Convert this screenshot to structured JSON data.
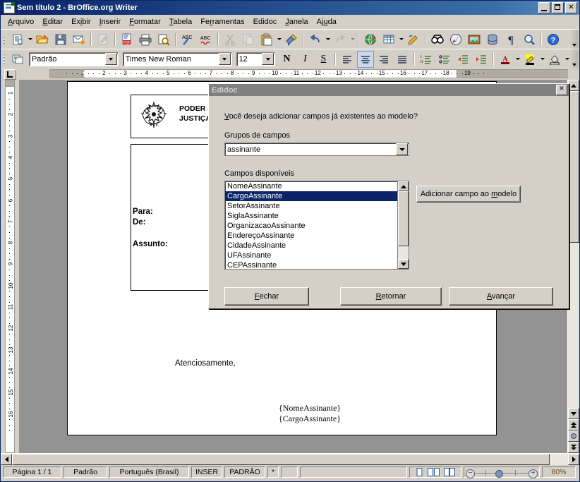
{
  "window": {
    "title": "Sem título 2 - BrOffice.org Writer",
    "icon": "writer-document-icon",
    "buttons": {
      "minimize": "minimize-button",
      "maximize": "maximize-button",
      "close_label": "✕"
    }
  },
  "menubar": [
    {
      "label": "Arquivo",
      "accel": "A"
    },
    {
      "label": "Editar",
      "accel": "E"
    },
    {
      "label": "Exibir",
      "accel": "i"
    },
    {
      "label": "Inserir",
      "accel": "I"
    },
    {
      "label": "Formatar",
      "accel": "F"
    },
    {
      "label": "Tabela",
      "accel": "T"
    },
    {
      "label": "Ferramentas",
      "accel": "r"
    },
    {
      "label": "Edidoc",
      "accel": "d"
    },
    {
      "label": "Janela",
      "accel": "J"
    },
    {
      "label": "Ajuda",
      "accel": "u"
    }
  ],
  "standard_toolbar": [
    {
      "name": "new-document-icon",
      "tip": "Novo"
    },
    {
      "name": "new-dropdown-arrow",
      "tip": "Novo (menu)"
    },
    {
      "name": "open-folder-icon",
      "tip": "Abrir"
    },
    {
      "name": "save-icon",
      "tip": "Salvar"
    },
    {
      "name": "send-email-icon",
      "tip": "Documento como e-mail"
    },
    {
      "name": "edit-file-icon",
      "tip": "Editar arquivo"
    },
    {
      "name": "export-pdf-icon",
      "tip": "Exportar como PDF"
    },
    {
      "name": "print-icon",
      "tip": "Imprimir"
    },
    {
      "name": "print-preview-icon",
      "tip": "Visualizar página"
    },
    {
      "name": "spellcheck-icon",
      "tip": "Ortografia e gramática"
    },
    {
      "name": "autospellcheck-icon",
      "tip": "Verificação ortográfica automática"
    },
    {
      "name": "cut-icon",
      "tip": "Cortar"
    },
    {
      "name": "copy-icon",
      "tip": "Copiar"
    },
    {
      "name": "paste-icon",
      "tip": "Colar"
    },
    {
      "name": "paste-dropdown-arrow",
      "tip": "Colar (menu)"
    },
    {
      "name": "clone-formatting-icon",
      "tip": "Pincel de estilo"
    },
    {
      "name": "undo-icon",
      "tip": "Desfazer"
    },
    {
      "name": "undo-dropdown-arrow",
      "tip": "Desfazer (menu)"
    },
    {
      "name": "redo-icon",
      "tip": "Refazer"
    },
    {
      "name": "redo-dropdown-arrow",
      "tip": "Refazer (menu)"
    },
    {
      "name": "hyperlink-icon",
      "tip": "Hyperlink"
    },
    {
      "name": "insert-table-icon",
      "tip": "Tabela"
    },
    {
      "name": "table-dropdown-arrow",
      "tip": "Tabela (menu)"
    },
    {
      "name": "show-draw-functions-icon",
      "tip": "Funções de desenho"
    },
    {
      "name": "find-replace-icon",
      "tip": "Localizar e substituir"
    },
    {
      "name": "navigator-icon",
      "tip": "Navegador"
    },
    {
      "name": "gallery-icon",
      "tip": "Galeria"
    },
    {
      "name": "data-sources-icon",
      "tip": "Fontes de dados"
    },
    {
      "name": "formatting-marks-icon",
      "tip": "Caracteres não imprimíveis"
    },
    {
      "name": "zoom-icon",
      "tip": "Zoom"
    },
    {
      "name": "help-icon",
      "tip": "Ajuda do BrOffice.org"
    }
  ],
  "format_toolbar": {
    "paragraph_style_icon": "apply-style-icon",
    "paragraph_style": "Padrão",
    "font_name": "Times New Roman",
    "font_size": "12",
    "bold": "N",
    "italic": "I",
    "underline": "S",
    "buttons": [
      {
        "name": "align-left-button",
        "active": false
      },
      {
        "name": "align-center-button",
        "active": true
      },
      {
        "name": "align-right-button",
        "active": false
      },
      {
        "name": "justify-button",
        "active": false
      },
      {
        "name": "ordered-list-button",
        "active": false
      },
      {
        "name": "unordered-list-button",
        "active": false
      },
      {
        "name": "decrease-indent-button",
        "active": false
      },
      {
        "name": "increase-indent-button",
        "active": false
      },
      {
        "name": "font-color-button",
        "active": false
      },
      {
        "name": "highlighting-button",
        "active": false
      },
      {
        "name": "background-color-button",
        "active": false
      }
    ]
  },
  "rulers": {
    "horizontal_ticks": [
      "1",
      "2",
      "3",
      "4",
      "5",
      "6",
      "7",
      "8",
      "9",
      "10",
      "11",
      "12",
      "13",
      "14",
      "15",
      "16",
      "17",
      "18",
      "19"
    ],
    "vertical_ticks": [
      "1",
      "2",
      "3",
      "4",
      "5",
      "6",
      "7",
      "8",
      "9",
      "10",
      "11",
      "12",
      "13",
      "14",
      "15",
      "16"
    ]
  },
  "document": {
    "emblem_icon": "brazil-coat-of-arms-icon",
    "header_line1": "PODER JU",
    "header_line2": "JUSTIÇA D",
    "label_para": "Para:",
    "label_de": "De:",
    "label_assunto": "Assunto:",
    "closing": "Atenciosamente,",
    "field_name": "{NomeAssinante}",
    "field_cargo": "{CargoAssinante}"
  },
  "dialog": {
    "title": "Edidoc",
    "close_label": "✕",
    "question": "Você deseja adicionar campos já existentes ao modelo?",
    "question_accel": "V",
    "group_label": "Grupos de campos",
    "group_value": "assinante",
    "fields_label": "Campos disponíveis",
    "fields": [
      "NomeAssinante",
      "CargoAssinante",
      "SetorAssinante",
      "SiglaAssinante",
      "OrganizacaoAssinante",
      "EndereçoAssinante",
      "CidadeAssinante",
      "UFAssinante",
      "CEPAssinante"
    ],
    "selected_field": "CargoAssinante",
    "add_button": "Adicionar campo ao modelo",
    "add_button_accel": "m",
    "buttons": [
      {
        "label": "Fechar",
        "accel": "F"
      },
      {
        "label": "Retornar",
        "accel": "R"
      },
      {
        "label": "Avançar",
        "accel": "A"
      }
    ]
  },
  "statusbar": {
    "page": "Página 1 / 1",
    "style": "Padrão",
    "language": "Português (Brasil)",
    "insert_mode": "INSER",
    "selection_mode": "PADRÃO",
    "modified": "*",
    "signature": "",
    "section": "",
    "view_single": "single-page-view-icon",
    "view_multi": "multi-page-view-icon",
    "view_book": "book-view-icon",
    "zoom_out": "−",
    "zoom_in": "+",
    "zoom_level": "80%"
  },
  "colors": {
    "titlebar_start": "#0a246a",
    "titlebar_end": "#5b8cc4",
    "face": "#d4d0c8",
    "selection": "#0a246a",
    "canvas": "#939393",
    "dialog_title": "#808080"
  }
}
